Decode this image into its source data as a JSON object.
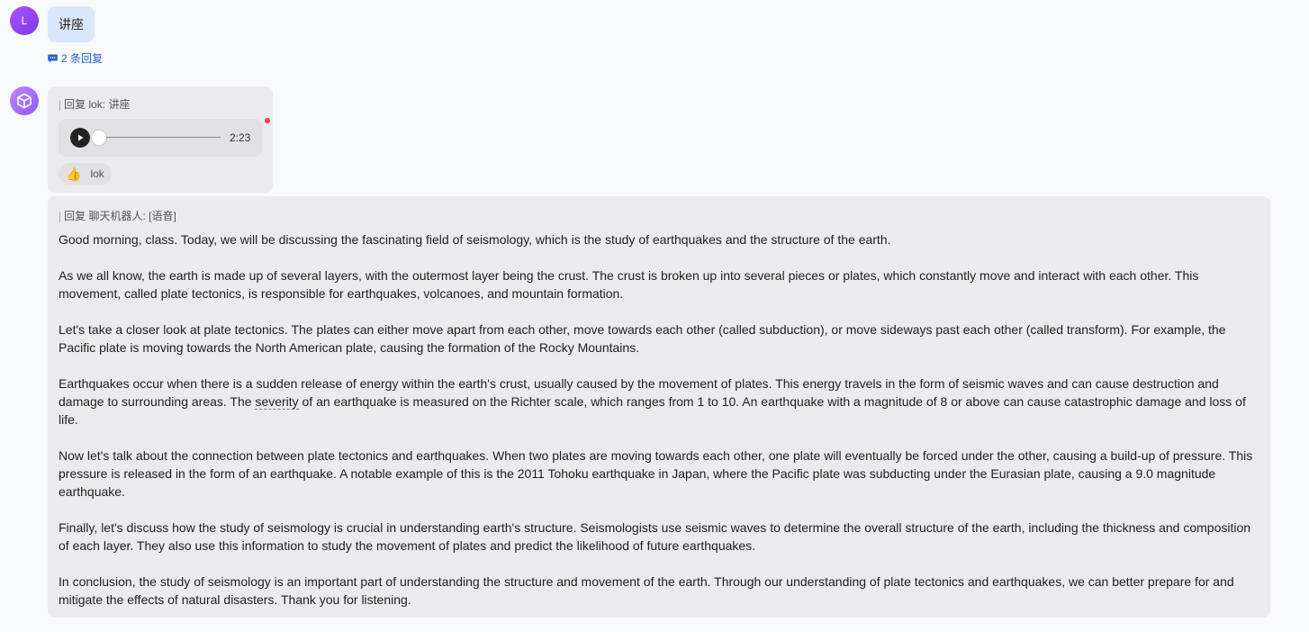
{
  "user_message": {
    "avatar_initial": "L",
    "text": "讲座",
    "reply_count_label": "2 条回复"
  },
  "voice_reply": {
    "quote_bar": "|",
    "quote": "回复 lok: 讲座",
    "audio": {
      "duration": "2:23",
      "progress": 0.0
    },
    "reaction": {
      "emoji": "👍",
      "user": "lok"
    }
  },
  "text_reply": {
    "quote_bar": "|",
    "quote": "回复 聊天机器人: [语音]",
    "paragraphs": {
      "p1": "Good morning, class. Today, we will be discussing the fascinating field of seismology, which is the study of earthquakes and the structure of the earth.",
      "p2": "As we all know, the earth is made up of several layers, with the outermost layer being the crust. The crust is broken up into several pieces or plates, which constantly move and interact with each other. This movement, called plate tectonics, is responsible for earthquakes, volcanoes, and mountain formation.",
      "p3": "Let's take a closer look at plate tectonics. The plates can either move apart from each other, move towards each other (called subduction), or move sideways past each other (called transform). For example, the Pacific plate is moving towards the North American plate, causing the formation of the Rocky Mountains.",
      "p4_before": "Earthquakes occur when there is a sudden release of energy within the earth's crust, usually caused by the movement of plates. This energy travels in the form of seismic waves and can cause destruction and damage to surrounding areas. The ",
      "p4_marked": "severity",
      "p4_after": " of an earthquake is measured on the Richter scale, which ranges from 1 to 10. An earthquake with a magnitude of 8 or above can cause catastrophic damage and loss of life.",
      "p5": "Now let's talk about the connection between plate tectonics and earthquakes. When two plates are moving towards each other, one plate will eventually be forced under the other, causing a build-up of pressure. This pressure is released in the form of an earthquake. A notable example of this is the 2011 Tohoku earthquake in Japan, where the Pacific plate was subducting under the Eurasian plate, causing a 9.0 magnitude earthquake.",
      "p6": "Finally, let's discuss how the study of seismology is crucial in understanding earth's structure. Seismologists use seismic waves to determine the overall structure of the earth, including the thickness and composition of each layer. They also use this information to study the movement of plates and predict the likelihood of future earthquakes.",
      "p7": "In conclusion, the study of seismology is an important part of understanding the structure and movement of the earth. Through our understanding of plate tectonics and earthquakes, we can better prepare for and mitigate the effects of natural disasters. Thank you for listening."
    }
  },
  "icons": {
    "reply_count": "message-icon",
    "bot_avatar": "cube-icon",
    "play": "play-icon",
    "reaction": "thumbs-up-icon"
  },
  "colors": {
    "background": "#f8f9fb",
    "user_bubble": "#d9e7fb",
    "bot_bubble": "#ebebee",
    "link": "#2b62c9",
    "unread": "#f04438"
  }
}
